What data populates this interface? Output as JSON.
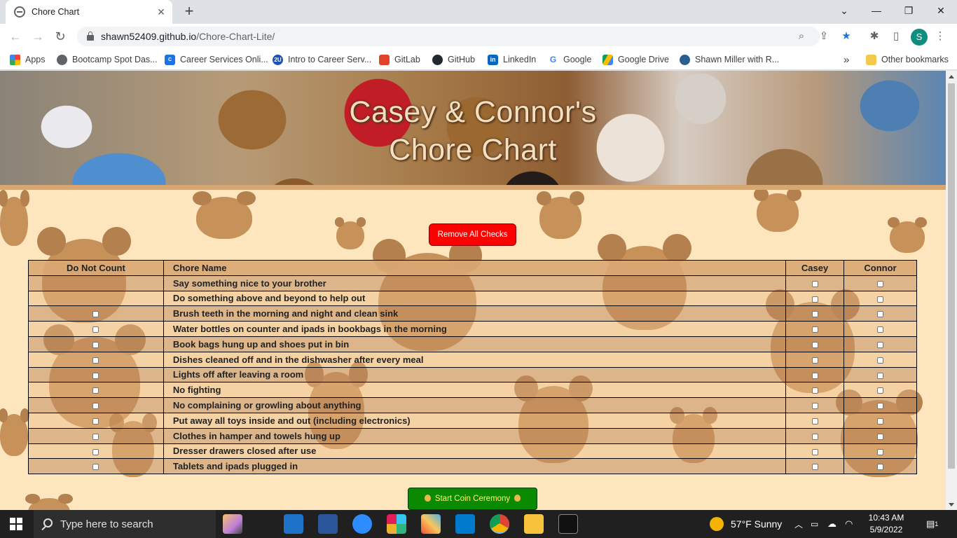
{
  "browser": {
    "tab_title": "Chore Chart",
    "new_tab": "+",
    "url_host": "shawn52409.github.io",
    "url_path": "/Chore-Chart-Lite/",
    "profile_initial": "S",
    "bookmarks": [
      {
        "label": "Apps",
        "icon": "apps-grid-icon",
        "color": "#ea4335"
      },
      {
        "label": "Bootcamp Spot Das...",
        "icon": "globe-icon",
        "color": "#5f6368"
      },
      {
        "label": "Career Services Onli...",
        "icon": "cen-icon",
        "color": "#1a73e8"
      },
      {
        "label": "Intro to Career Serv...",
        "icon": "2u-icon",
        "color": "#1f4fb8"
      },
      {
        "label": "GitLab",
        "icon": "gitlab-icon",
        "color": "#e24329"
      },
      {
        "label": "GitHub",
        "icon": "github-icon",
        "color": "#24292e"
      },
      {
        "label": "LinkedIn",
        "icon": "linkedin-icon",
        "color": "#0a66c2"
      },
      {
        "label": "Google",
        "icon": "google-icon",
        "color": "#4285f4"
      },
      {
        "label": "Google Drive",
        "icon": "google-drive-icon",
        "color": "#fbbc04"
      },
      {
        "label": "Shawn Miller with R...",
        "icon": "react-icon",
        "color": "#2b5e8e"
      }
    ],
    "more_bookmarks": "»",
    "other_bookmarks": "Other bookmarks"
  },
  "page": {
    "title_line1": "Casey & Connor's",
    "title_line2": "Chore Chart",
    "remove_button": "Remove All Checks",
    "coin_button": "Start Coin Ceremony",
    "table": {
      "headers": [
        "Do Not Count",
        "Chore Name",
        "Casey",
        "Connor"
      ],
      "rows": [
        {
          "name": "Say something nice to your brother",
          "do_not_count": false
        },
        {
          "name": "Do something above and beyond to help out",
          "do_not_count": false
        },
        {
          "name": "Brush teeth in the morning and night and clean sink",
          "do_not_count": true
        },
        {
          "name": "Water bottles on counter and ipads in bookbags in the morning",
          "do_not_count": true
        },
        {
          "name": "Book bags hung up and shoes put in bin",
          "do_not_count": true
        },
        {
          "name": "Dishes cleaned off and in the dishwasher after every meal",
          "do_not_count": true
        },
        {
          "name": "Lights off after leaving a room",
          "do_not_count": true
        },
        {
          "name": "No fighting",
          "do_not_count": true
        },
        {
          "name": "No complaining or growling about anything",
          "do_not_count": true
        },
        {
          "name": "Put away all toys inside and out (including electronics)",
          "do_not_count": true
        },
        {
          "name": "Clothes in hamper and towels hung up",
          "do_not_count": true
        },
        {
          "name": "Dresser drawers closed after use",
          "do_not_count": true
        },
        {
          "name": "Tablets and ipads plugged in",
          "do_not_count": true
        }
      ]
    },
    "colors": {
      "remove_button": "#ff0000",
      "coin_button": "#0a8a00",
      "background": "#fde6bd"
    }
  },
  "taskbar": {
    "search_placeholder": "Type here to search",
    "weather": "57°F  Sunny",
    "time": "10:43 AM",
    "date": "5/9/2022",
    "notification_count": "1"
  }
}
